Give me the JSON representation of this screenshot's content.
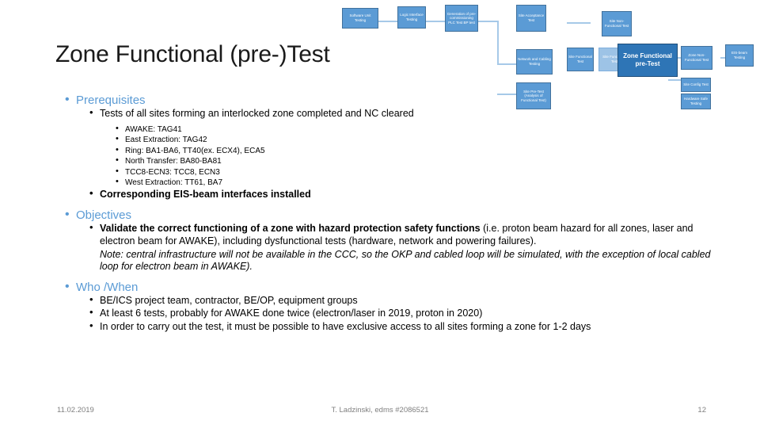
{
  "slide": {
    "title": "Zone Functional (pre-)Test",
    "sections": [
      {
        "heading": "Prerequisites",
        "items": [
          {
            "text": "Tests of all sites forming an interlocked zone completed and NC cleared",
            "bold": false,
            "subitems": [
              "AWAKE: TAG41",
              "East Extraction: TAG42",
              "Ring: BA1-BA6, TT40(ex. ECX4), ECA5",
              "North Transfer: BA80-BA81",
              "TCC8-ECN3: TCC8, ECN3",
              "West Extraction: TT61, BA7"
            ]
          },
          {
            "text": "Corresponding EIS-beam interfaces installed",
            "bold": true,
            "subitems": []
          }
        ],
        "note": ""
      },
      {
        "heading": "Objectives",
        "items": [
          {
            "text": "Validate the correct functioning of a zone with hazard protection safety functions (i.e. proton beam hazard for all zones, laser and electron beam for AWAKE), including dysfunctional tests (hardware, network and powering failures).",
            "bold": true,
            "partial_bold_upto": "Validate the correct functioning of a zone with hazard protection safety functions",
            "subitems": []
          }
        ],
        "note": "Note: central infrastructure will not be available in the CCC, so the OKP and cabled loop will be simulated, with the exception of local cabled loop for electron beam in AWAKE)."
      },
      {
        "heading": "Who /When",
        "items": [
          {
            "text": "BE/ICS project team, contractor, BE/OP, equipment groups",
            "bold": false,
            "subitems": []
          },
          {
            "text": "At least 6 tests, probably for AWAKE done twice (electron/laser in 2019, proton in 2020)",
            "bold": false,
            "subitems": []
          },
          {
            "text": "In order to carry out the test, it must be possible to have exclusive access to all sites forming a zone for 1-2 days",
            "bold": false,
            "subitems": []
          }
        ],
        "note": ""
      }
    ]
  },
  "diagram": {
    "highlight_label": "Zone Functional pre-Test",
    "nodes": [
      {
        "label": "Software Unit Testing"
      },
      {
        "label": "Logic Interface Testing"
      },
      {
        "label": "Generation of pre-commissioning PLC Test BP test"
      },
      {
        "label": "Site Acceptance Test"
      },
      {
        "label": "Site Functional Test"
      },
      {
        "label": "Network and Cabling Testing"
      },
      {
        "label": "Site Non-Functional Test"
      },
      {
        "label": "Site Functional Test"
      },
      {
        "label": "Site Pre-Test (Analysis of Functional Test)"
      },
      {
        "label": "Zone Non-Functional Test"
      },
      {
        "label": "EIS-beam Testing"
      },
      {
        "label": "Site Config Test"
      },
      {
        "label": "Hardware Safe Testing"
      }
    ]
  },
  "footer": {
    "date": "11.02.2019",
    "center": "T. Ladzinski, edms #2086521",
    "page": "12"
  },
  "colors": {
    "accent": "#5b9bd5",
    "highlight": "#2e75b6",
    "footer_text": "#7f7f7f"
  }
}
